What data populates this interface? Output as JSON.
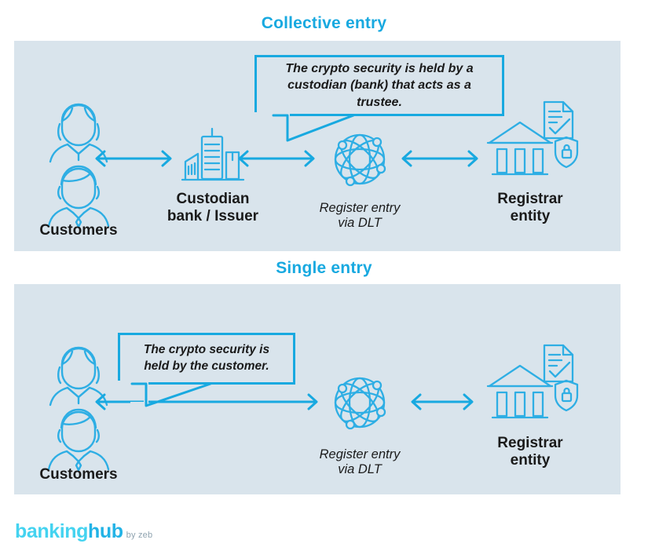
{
  "colors": {
    "accent": "#18A9E0",
    "panel_bg": "#D9E4EC",
    "page_bg": "#FFFFFF",
    "text": "#1A1A1A",
    "logo_light": "#44D3F0",
    "logo_dark": "#22B3E6",
    "logo_gray": "#8FA3B0"
  },
  "sections": [
    {
      "id": "collective",
      "title": "Collective entry",
      "callout": "The crypto security is held by a custodian (bank) that acts as a trustee.",
      "nodes": [
        {
          "id": "customers",
          "label": "Customers",
          "icon": "two-persons-icon"
        },
        {
          "id": "custodian",
          "label": "Custodian\nbank / Issuer",
          "icon": "city-buildings-icon"
        },
        {
          "id": "dlt",
          "label": "Register entry\nvia DLT",
          "icon": "globe-network-icon"
        },
        {
          "id": "registrar",
          "label": "Registrar\nentity",
          "icon": "bank-building-icon"
        }
      ],
      "connectors": [
        "double-arrow",
        "double-arrow",
        "double-arrow"
      ]
    },
    {
      "id": "single",
      "title": "Single entry",
      "callout": "The crypto security is held by the customer.",
      "nodes": [
        {
          "id": "customers",
          "label": "Customers",
          "icon": "two-persons-icon"
        },
        {
          "id": "dlt",
          "label": "Register entry\nvia DLT",
          "icon": "globe-network-icon"
        },
        {
          "id": "registrar",
          "label": "Registrar\nentity",
          "icon": "bank-building-icon"
        }
      ],
      "connectors": [
        "double-arrow",
        "double-arrow"
      ]
    }
  ],
  "logo": {
    "part1": "banking",
    "part2": "hub",
    "part3": "by zeb"
  }
}
